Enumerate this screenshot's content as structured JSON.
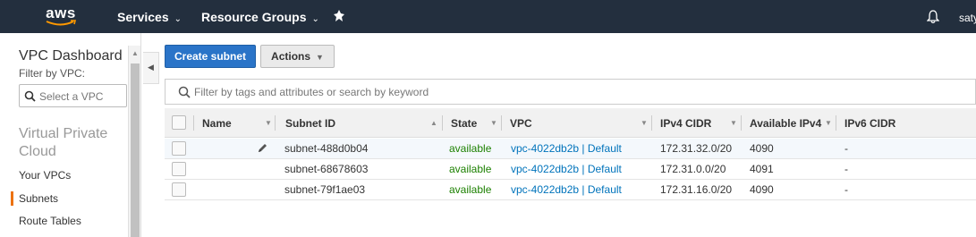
{
  "topnav": {
    "logo": "aws",
    "services": "Services",
    "resource_groups": "Resource Groups",
    "user": "saty"
  },
  "sidebar": {
    "title": "VPC Dashboard",
    "filter_label": "Filter by VPC:",
    "select_placeholder": "Select a VPC",
    "section_title": "Virtual Private Cloud",
    "links": [
      "Your VPCs",
      "Subnets",
      "Route Tables"
    ]
  },
  "toolbar": {
    "create_label": "Create subnet",
    "actions_label": "Actions"
  },
  "search": {
    "placeholder": "Filter by tags and attributes or search by keyword"
  },
  "table": {
    "columns": [
      "Name",
      "Subnet ID",
      "State",
      "VPC",
      "IPv4 CIDR",
      "Available IPv4",
      "IPv6 CIDR"
    ],
    "rows": [
      {
        "name": "",
        "subnet_id": "subnet-488d0b04",
        "state": "available",
        "vpc": "vpc-4022db2b | Default",
        "ipv4_cidr": "172.31.32.0/20",
        "available_ipv4": "4090",
        "ipv6_cidr": "-"
      },
      {
        "name": "",
        "subnet_id": "subnet-68678603",
        "state": "available",
        "vpc": "vpc-4022db2b | Default",
        "ipv4_cidr": "172.31.0.0/20",
        "available_ipv4": "4091",
        "ipv6_cidr": "-"
      },
      {
        "name": "",
        "subnet_id": "subnet-79f1ae03",
        "state": "available",
        "vpc": "vpc-4022db2b | Default",
        "ipv4_cidr": "172.31.16.0/20",
        "available_ipv4": "4090",
        "ipv6_cidr": "-"
      }
    ]
  },
  "colors": {
    "nav_bg": "#232f3e",
    "primary_button": "#2a74c8",
    "state_available": "#1d8102",
    "link": "#0073bb",
    "active_indicator": "#ec7211"
  },
  "icons": [
    "aws-smile-icon",
    "chevron-down-icon",
    "pin-icon",
    "bell-icon",
    "search-icon",
    "collapse-left-icon",
    "sort-icon",
    "pencil-icon"
  ]
}
